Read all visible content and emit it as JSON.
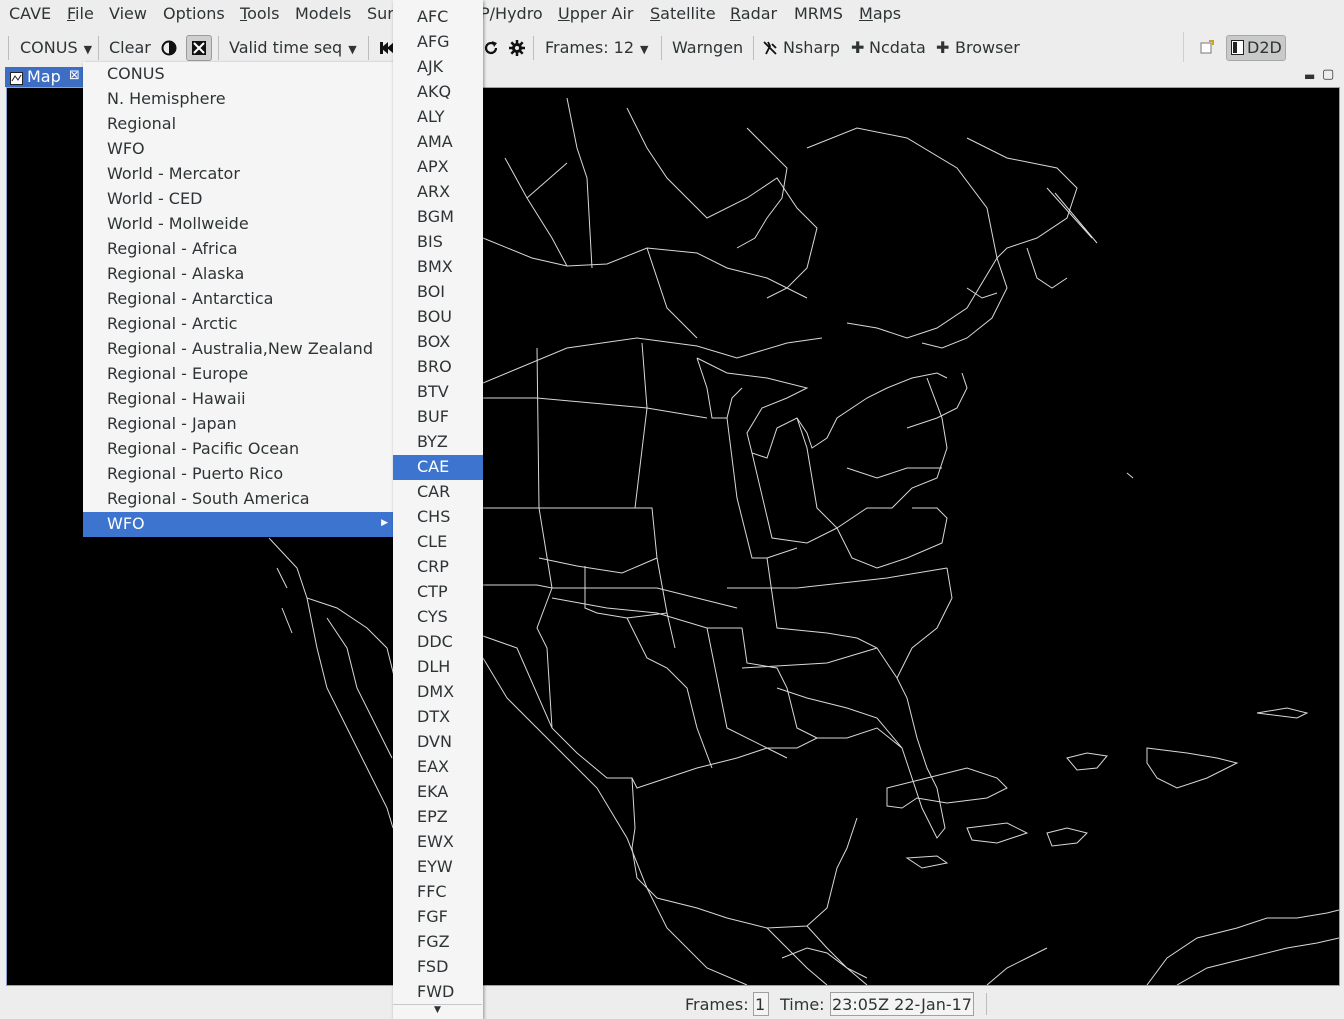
{
  "menubar": {
    "items": [
      "CAVE",
      "File",
      "View",
      "Options",
      "Tools",
      "Models",
      "Sur",
      "P/Hydro",
      "Upper Air",
      "Satellite",
      "Radar",
      "MRMS",
      "Maps"
    ]
  },
  "toolbar": {
    "scale": "CONUS",
    "clear": "Clear",
    "loop_mode": "Valid time seq",
    "frames": "Frames: 12",
    "warngen": "Warngen",
    "nsharp": "Nsharp",
    "ncdata": "Ncdata",
    "browser": "Browser",
    "perspective": "D2D"
  },
  "editor_tab": {
    "label": "Map"
  },
  "status": {
    "frames_label": "Frames:",
    "frames_value": "1",
    "time_label": "Time:",
    "time_value": "23:05Z 22-Jan-17"
  },
  "scale_menu": {
    "items": [
      "CONUS",
      "N. Hemisphere",
      "Regional",
      "WFO",
      "World - Mercator",
      "World - CED",
      "World - Mollweide",
      "Regional - Africa",
      "Regional - Alaska",
      "Regional - Antarctica",
      "Regional - Arctic",
      "Regional - Australia,New Zealand",
      "Regional - Europe",
      "Regional - Hawaii",
      "Regional - Japan",
      "Regional - Pacific Ocean",
      "Regional - Puerto Rico",
      "Regional - South America",
      "WFO"
    ],
    "selected_index": 18
  },
  "wfo_submenu": {
    "items": [
      "AFC",
      "AFG",
      "AJK",
      "AKQ",
      "ALY",
      "AMA",
      "APX",
      "ARX",
      "BGM",
      "BIS",
      "BMX",
      "BOI",
      "BOU",
      "BOX",
      "BRO",
      "BTV",
      "BUF",
      "BYZ",
      "CAE",
      "CAR",
      "CHS",
      "CLE",
      "CRP",
      "CTP",
      "CYS",
      "DDC",
      "DLH",
      "DMX",
      "DTX",
      "DVN",
      "EAX",
      "EKA",
      "EPZ",
      "EWX",
      "EYW",
      "FFC",
      "FGF",
      "FGZ",
      "FSD",
      "FWD"
    ],
    "selected": "CAE"
  },
  "colors": {
    "selection": "#3c74cf",
    "map_background": "#000000",
    "map_lines": "#d8d8d8"
  }
}
